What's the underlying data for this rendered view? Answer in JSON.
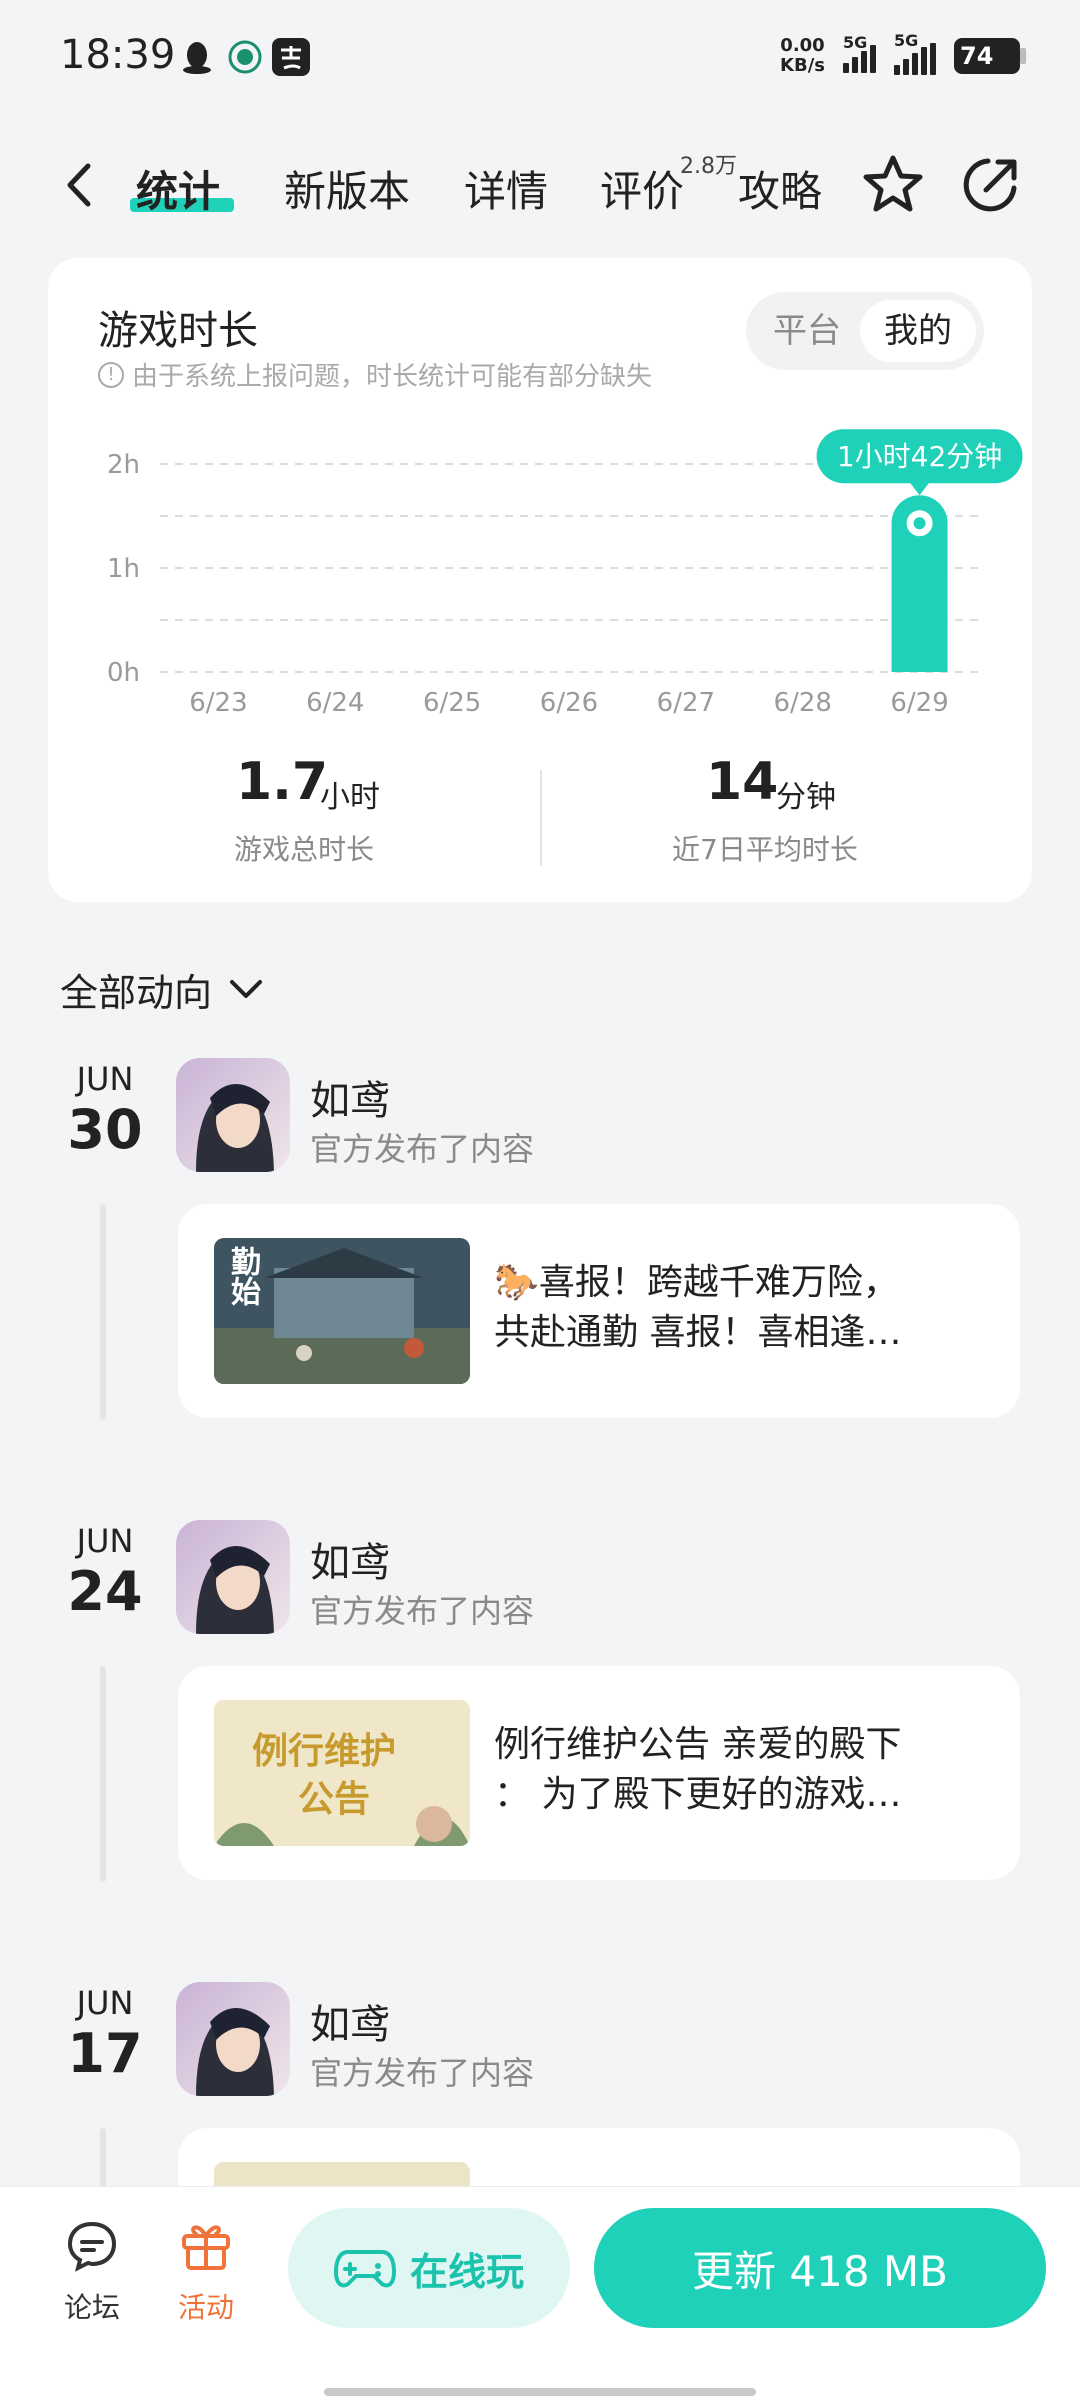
{
  "status_bar": {
    "time": "18:39",
    "net_speed_value": "0.00",
    "net_speed_unit": "KB/s",
    "signal1_label": "5G",
    "signal2_label": "5G",
    "battery": "74"
  },
  "nav": {
    "tabs": [
      "统计",
      "新版本",
      "详情",
      "评价",
      "攻略"
    ],
    "active_tab": "统计",
    "review_count_badge": "2.8万"
  },
  "stats": {
    "title": "游戏时长",
    "note": "由于系统上报问题，时长统计可能有部分缺失",
    "toggle_options": [
      "平台",
      "我的"
    ],
    "toggle_selected": "我的",
    "total_value": "1.7",
    "total_unit": "小时",
    "total_label": "游戏总时长",
    "avg_value": "14",
    "avg_unit": "分钟",
    "avg_label": "近7日平均时长"
  },
  "chart_data": {
    "type": "bar",
    "categories": [
      "6/23",
      "6/24",
      "6/25",
      "6/26",
      "6/27",
      "6/28",
      "6/29"
    ],
    "values": [
      0,
      0,
      0,
      0,
      0,
      0,
      1.7
    ],
    "y_ticks": [
      "0h",
      "1h",
      "2h"
    ],
    "ylim": [
      0,
      2
    ],
    "tooltip": "1小时42分钟",
    "highlight_index": 6,
    "grid": true,
    "bar_color": "#1fd1b9"
  },
  "feed": {
    "filter_label": "全部动向",
    "items": [
      {
        "month": "JUN",
        "day": "30",
        "author": "如鸢",
        "action": "官方发布了内容",
        "text_line1": "🐎喜报！跨越千难万险，",
        "text_line2": "共赴通勤 喜报！喜相逢…",
        "thumb_text": "勤始"
      },
      {
        "month": "JUN",
        "day": "24",
        "author": "如鸢",
        "action": "官方发布了内容",
        "text_line1": "例行维护公告 亲爱的殿下",
        "text_line2": "：  为了殿下更好的游戏…",
        "thumb_text1": "例行维护",
        "thumb_text2": "公告"
      },
      {
        "month": "JUN",
        "day": "17",
        "author": "如鸢",
        "action": "官方发布了内容"
      }
    ]
  },
  "bottom_bar": {
    "forum_label": "论坛",
    "events_label": "活动",
    "play_online_label": "在线玩",
    "update_label": "更新 418 MB"
  },
  "colors": {
    "accent": "#1fd1b9",
    "events": "#f0743a"
  }
}
